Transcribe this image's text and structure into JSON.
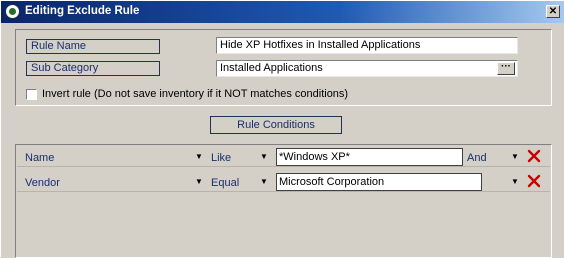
{
  "window": {
    "title": "Editing Exclude Rule",
    "close_label": "✕"
  },
  "form": {
    "rule_name_label": "Rule Name",
    "rule_name_value": "Hide XP Hotfixes in Installed Applications",
    "sub_category_label": "Sub Category",
    "sub_category_value": "Installed Applications",
    "browse_label": "···",
    "invert_rule_label": "Invert rule (Do not save inventory if it NOT matches conditions)",
    "invert_rule_checked": false
  },
  "conditions": {
    "button_label": "Rule Conditions",
    "rows": [
      {
        "field": "Name",
        "operator": "Like",
        "value": "*Windows XP*",
        "joiner": "And"
      },
      {
        "field": "Vendor",
        "operator": "Equal",
        "value": "Microsoft Corporation",
        "joiner": ""
      }
    ]
  },
  "colors": {
    "title_bar": "#0a246a",
    "label_text": "#1a2e6e",
    "delete_icon": "#cc0000",
    "dialog_bg": "#d4d0c8"
  },
  "icons": {
    "app": "app-logo-icon",
    "close": "close-icon",
    "dropdown": "dropdown-arrow-icon",
    "delete": "delete-x-icon"
  }
}
